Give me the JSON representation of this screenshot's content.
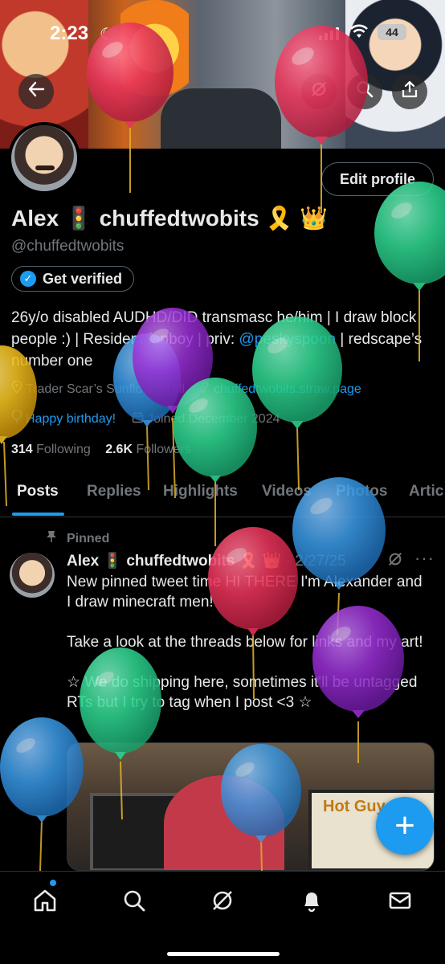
{
  "status_bar": {
    "time": "2:23",
    "battery": "44"
  },
  "profile": {
    "name": "Alex 🚦 chuffedtwobits 🎗️ 👑",
    "handle": "@chuffedtwobits",
    "edit_button": "Edit profile",
    "verify_button": "Get verified",
    "bio_part1": "26y/o disabled AUDHD/DID transmasc he/him | I draw block people :) | Resident fanboy | priv: ",
    "bio_link": "@peskyspoon",
    "bio_part2": " | redscape’s number one",
    "location": "Trader Scar’s Sunflower Hill",
    "website": "chuffedtwobits.straw.page",
    "birthday": "Happy birthday!",
    "joined": "Joined December 2024",
    "following_count": "314",
    "following_label": "Following",
    "followers_count": "2.6K",
    "followers_label": "Followers"
  },
  "tabs": [
    "Posts",
    "Replies",
    "Highlights",
    "Videos",
    "Photos",
    "Artic"
  ],
  "post": {
    "pinned_label": "Pinned",
    "author": "Alex 🚦 chuffedtwobits 🎗️ 👑",
    "date": "· 2/27/25",
    "more": "···",
    "paragraphs": [
      "New pinned tweet time HI THERE I'm Alexander and I draw minecraft men!",
      "Take a look at the threads below for links and my art!",
      "☆ We do shipping here, sometimes it'll be untagged RTs but I try to tag when I post <3 ☆"
    ],
    "media_sign": "Hot Guy"
  },
  "fab": "+",
  "colors": {
    "accent": "#1d9bf0",
    "background": "#000000",
    "muted": "#71767b",
    "text": "#e7e9ea",
    "balloon_red": "#e8345a",
    "balloon_green": "#2ed38f",
    "balloon_blue": "#3a9be8",
    "balloon_purple": "#9b30d8",
    "balloon_yellow": "#f0c020"
  },
  "icons": [
    "back-arrow-icon",
    "grok-icon",
    "search-icon",
    "share-icon",
    "location-icon",
    "link-icon",
    "balloon-icon",
    "calendar-icon",
    "pin-icon",
    "home-icon",
    "search-icon",
    "grok-icon",
    "bell-icon",
    "mail-icon"
  ]
}
